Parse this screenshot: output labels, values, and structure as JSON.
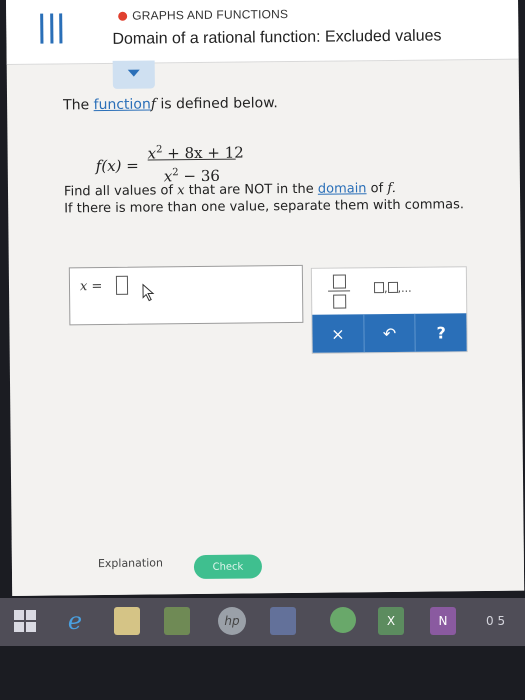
{
  "header": {
    "topic": "GRAPHS AND FUNCTIONS",
    "title": "Domain of a rational function: Excluded values"
  },
  "problem": {
    "intro_pre": "The ",
    "intro_link": "function",
    "intro_var": "f",
    "intro_post": " is defined below.",
    "equation": {
      "lhs": "f(x) =",
      "numerator_base": "x",
      "numerator_exp": "2",
      "numerator_rest": " + 8x + 12",
      "denominator_base": "x",
      "denominator_exp": "2",
      "denominator_rest": " − 36"
    },
    "instruction_line1_pre": "Find all values of ",
    "instruction_line1_var": "x",
    "instruction_line1_mid": " that are NOT in the ",
    "instruction_line1_link": "domain",
    "instruction_line1_post": " of ",
    "instruction_line1_var2": "f.",
    "instruction_line2": "If there is more than one value, separate them with commas."
  },
  "answer": {
    "label": "x ="
  },
  "keypad": {
    "list_sep": ",",
    "list_dots": "...",
    "clear_label": "×",
    "undo_label": "↶",
    "help_label": "?"
  },
  "footer": {
    "explanation_label": "Explanation",
    "check_label": "Check"
  },
  "taskbar": {
    "ie_label": "e",
    "hp_label": "hp",
    "excel_label": "X",
    "onenote_label": "N",
    "tray_text": "0 5"
  },
  "colors": {
    "accent": "#2a6fb8",
    "topic_dot": "#e0402f",
    "check": "#3fbf8f",
    "taskbar": "#4f4d57"
  }
}
